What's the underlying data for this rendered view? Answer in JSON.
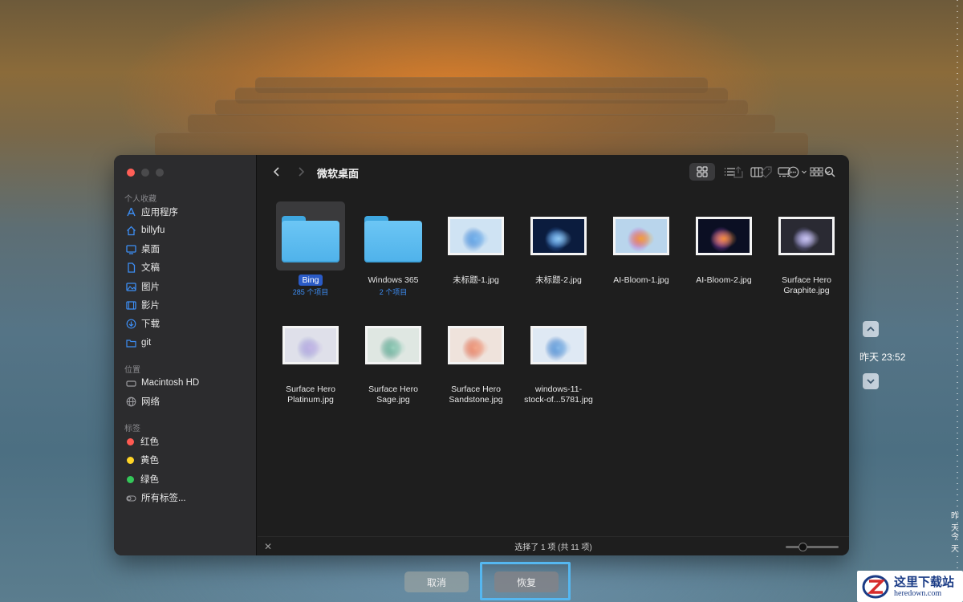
{
  "dialog": {
    "window_controls": [
      "close",
      "minimize",
      "zoom"
    ],
    "title": "微软桌面",
    "sidebar": {
      "favorites_title": "个人收藏",
      "favorites": [
        {
          "label": "应用程序",
          "icon": "apps-icon"
        },
        {
          "label": "billyfu",
          "icon": "home-icon"
        },
        {
          "label": "桌面",
          "icon": "desktop-icon"
        },
        {
          "label": "文稿",
          "icon": "document-icon"
        },
        {
          "label": "图片",
          "icon": "pictures-icon"
        },
        {
          "label": "影片",
          "icon": "movies-icon"
        },
        {
          "label": "下载",
          "icon": "download-icon"
        },
        {
          "label": "git",
          "icon": "folder-icon"
        }
      ],
      "locations_title": "位置",
      "locations": [
        {
          "label": "Macintosh HD",
          "icon": "disk-icon"
        },
        {
          "label": "网络",
          "icon": "network-icon"
        }
      ],
      "tags_title": "标签",
      "tags": [
        {
          "label": "红色",
          "color": "#ff5a52"
        },
        {
          "label": "黄色",
          "color": "#ffd426"
        },
        {
          "label": "绿色",
          "color": "#34c759"
        },
        {
          "label": "所有标签...",
          "icon": "all-tags-icon"
        }
      ]
    },
    "toolbar": {
      "back": "back-icon",
      "forward": "forward-icon",
      "view_icons": "icon-view-icon",
      "view_list": "list-view-icon",
      "view_columns": "column-view-icon",
      "view_gallery": "gallery-view-icon",
      "group": "group-icon",
      "share": "share-icon",
      "tag": "tag-icon",
      "more": "more-icon",
      "search": "search-icon"
    },
    "items": [
      {
        "name": "Bing",
        "sub": "285 个项目",
        "kind": "folder",
        "selected": true
      },
      {
        "name": "Windows 365",
        "sub": "2 个项目",
        "kind": "folder",
        "selected": false
      },
      {
        "name": "未标题-1.jpg",
        "sub": "",
        "kind": "image",
        "colors": [
          "#cfe3f3",
          "#3c7fd0",
          "#7db8ee"
        ]
      },
      {
        "name": "未标题-2.jpg",
        "sub": "",
        "kind": "image",
        "colors": [
          "#0b1c3e",
          "#3a7fd8",
          "#8fc6f0"
        ]
      },
      {
        "name": "AI-Bloom-1.jpg",
        "sub": "",
        "kind": "image",
        "colors": [
          "#b9d5ec",
          "#c84fc7",
          "#f2a23a"
        ]
      },
      {
        "name": "AI-Bloom-2.jpg",
        "sub": "",
        "kind": "image",
        "colors": [
          "#0b0f23",
          "#b24fd0",
          "#f28d3a"
        ]
      },
      {
        "name": "Surface Hero\nGraphite.jpg",
        "sub": "",
        "kind": "image",
        "colors": [
          "#2a2a33",
          "#8a86c8",
          "#c7c2ee"
        ]
      },
      {
        "name": "Surface Hero\nPlatinum.jpg",
        "sub": "",
        "kind": "image",
        "colors": [
          "#dfe0ea",
          "#9ea0d6",
          "#c3b6e6"
        ]
      },
      {
        "name": "Surface Hero\nSage.jpg",
        "sub": "",
        "kind": "image",
        "colors": [
          "#dfe7e2",
          "#3f8e7a",
          "#9ad0bd"
        ]
      },
      {
        "name": "Surface Hero\nSandstone.jpg",
        "sub": "",
        "kind": "image",
        "colors": [
          "#efe3dc",
          "#d8624a",
          "#f2a88c"
        ]
      },
      {
        "name": "windows-11-\nstock-of...5781.jpg",
        "sub": "",
        "kind": "image",
        "colors": [
          "#dfe9f4",
          "#2f6fc0",
          "#86b8e8"
        ]
      }
    ],
    "status": "选择了 1 项 (共 11 项)",
    "icon_size_fraction": 0.33
  },
  "buttons": {
    "cancel": "取消",
    "restore": "恢复"
  },
  "timemachine": {
    "current_snapshot": "昨天 23:52",
    "timeline_yesterday": "昨天",
    "timeline_today": "今天"
  },
  "watermark": {
    "cn": "这里下载站",
    "en": "heredown.com"
  }
}
